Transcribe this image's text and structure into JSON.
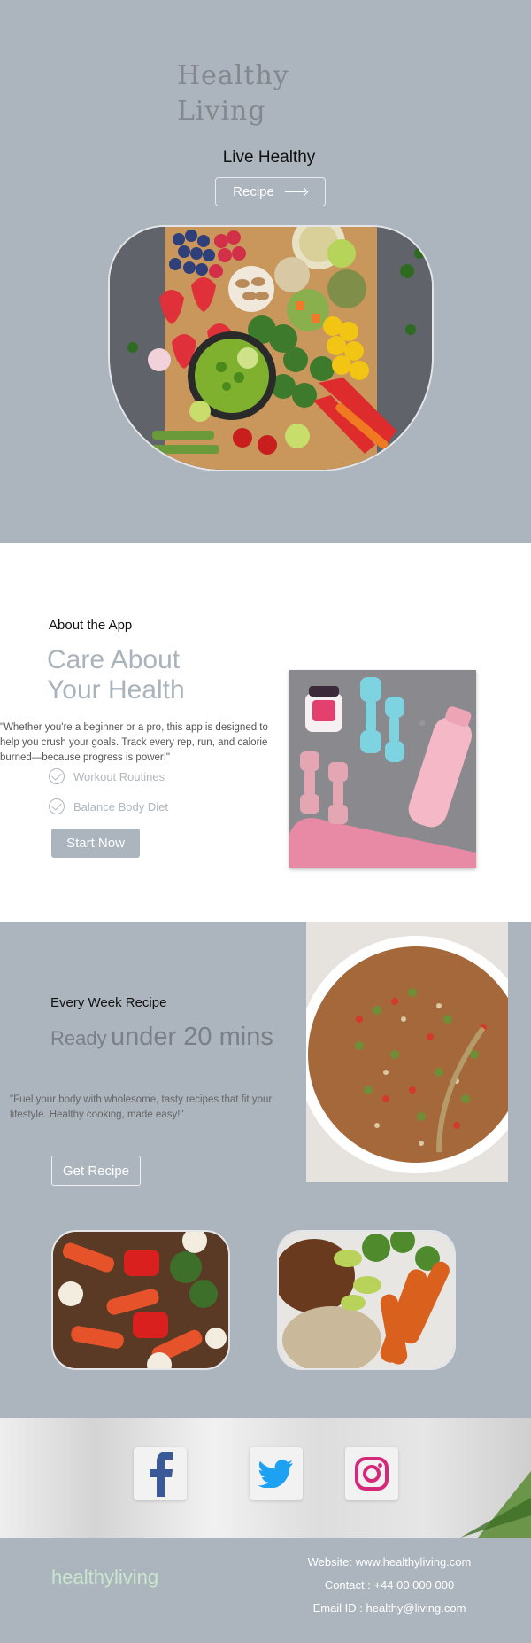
{
  "hero": {
    "logo_line1": "Healthy",
    "logo_line2": "Living",
    "tagline": "Live Healthy",
    "recipe_button": "Recipe",
    "recipe_button_icon": "arrow-right-icon"
  },
  "about": {
    "kicker": "About the App",
    "title_line1": "Care About",
    "title_line2": "Your Health",
    "quote": "\"Whether you're a beginner or a pro, this app is designed to help you crush your goals. Track every rep, run, and calorie burned—because progress is power!\"",
    "features": [
      {
        "label": "Workout Routines",
        "icon": "check-circle-icon"
      },
      {
        "label": "Balance Body Diet",
        "icon": "check-circle-icon"
      }
    ],
    "cta": "Start Now"
  },
  "recipe": {
    "kicker": "Every Week Recipe",
    "title_small": "Ready",
    "title_big": "under 20 mins",
    "quote": "\"Fuel your body with wholesome, tasty recipes that fit your lifestyle. Healthy cooking, made easy!\"",
    "cta": "Get Recipe"
  },
  "social": {
    "icons": [
      "facebook-icon",
      "twitter-icon",
      "instagram-icon"
    ]
  },
  "footer": {
    "logo": "healthyliving",
    "website": "Website: www.healthyliving.com",
    "contact": "Contact : +44 00 000 000",
    "email": "Email ID : healthy@living.com"
  },
  "colors": {
    "section_bg": "#acb4bd",
    "accent_text": "#aab2bb",
    "footer_logo": "#c9e7cf",
    "facebook": "#3b5998",
    "twitter": "#1da1f2",
    "instagram": "#d6287a"
  }
}
